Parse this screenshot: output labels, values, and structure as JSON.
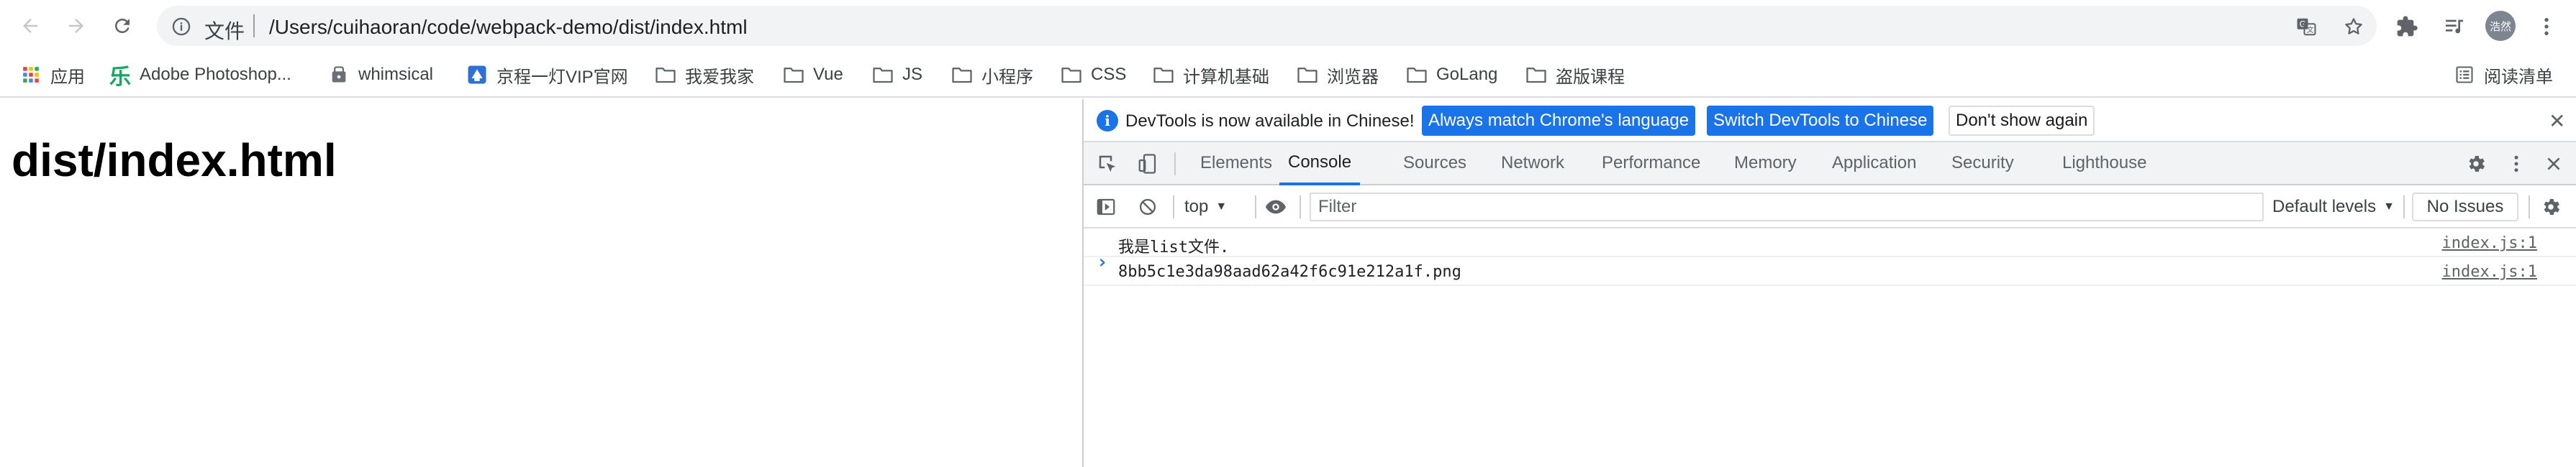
{
  "browser": {
    "omnibox": {
      "scheme_label": "文件",
      "url": "/Users/cuihaoran/code/webpack-demo/dist/index.html"
    },
    "profile": {
      "avatar_text": "浩然"
    },
    "bookmarks": [
      {
        "label": "应用",
        "icon": "apps-grid-icon"
      },
      {
        "label": "Adobe Photoshop...",
        "icon": "photoshop-icon"
      },
      {
        "label": "whimsical",
        "icon": "whimsical-icon"
      },
      {
        "label": "京程一灯VIP官网",
        "icon": "site-logo-icon"
      },
      {
        "label": "我爱我家",
        "icon": "folder-icon"
      },
      {
        "label": "Vue",
        "icon": "folder-icon"
      },
      {
        "label": "JS",
        "icon": "folder-icon"
      },
      {
        "label": "小程序",
        "icon": "folder-icon"
      },
      {
        "label": "CSS",
        "icon": "folder-icon"
      },
      {
        "label": "计算机基础",
        "icon": "folder-icon"
      },
      {
        "label": "浏览器",
        "icon": "folder-icon"
      },
      {
        "label": "GoLang",
        "icon": "folder-icon"
      },
      {
        "label": "盗版课程",
        "icon": "folder-icon"
      }
    ],
    "reading_list": {
      "label": "阅读清单"
    }
  },
  "page": {
    "heading": "dist/index.html"
  },
  "devtools": {
    "infobar": {
      "message": "DevTools is now available in Chinese!",
      "match_button": "Always match Chrome's language",
      "switch_button": "Switch DevTools to Chinese",
      "dismiss_button": "Don't show again"
    },
    "tabs": [
      {
        "label": "Elements"
      },
      {
        "label": "Console",
        "active": true
      },
      {
        "label": "Sources"
      },
      {
        "label": "Network"
      },
      {
        "label": "Performance"
      },
      {
        "label": "Memory"
      },
      {
        "label": "Application"
      },
      {
        "label": "Security"
      },
      {
        "label": "Lighthouse"
      }
    ],
    "console": {
      "context": "top",
      "filter_placeholder": "Filter",
      "levels": "Default levels",
      "issues": "No Issues",
      "messages": [
        {
          "text": "我是list文件.",
          "source": "index.js:1"
        },
        {
          "text": "8bb5c1e3da98aad62a42f6c91e212a1f.png",
          "source": "index.js:1"
        }
      ],
      "prompt": "›"
    }
  },
  "colors": {
    "accent": "#1a73e8",
    "chrome_bg": "#f1f3f4"
  }
}
